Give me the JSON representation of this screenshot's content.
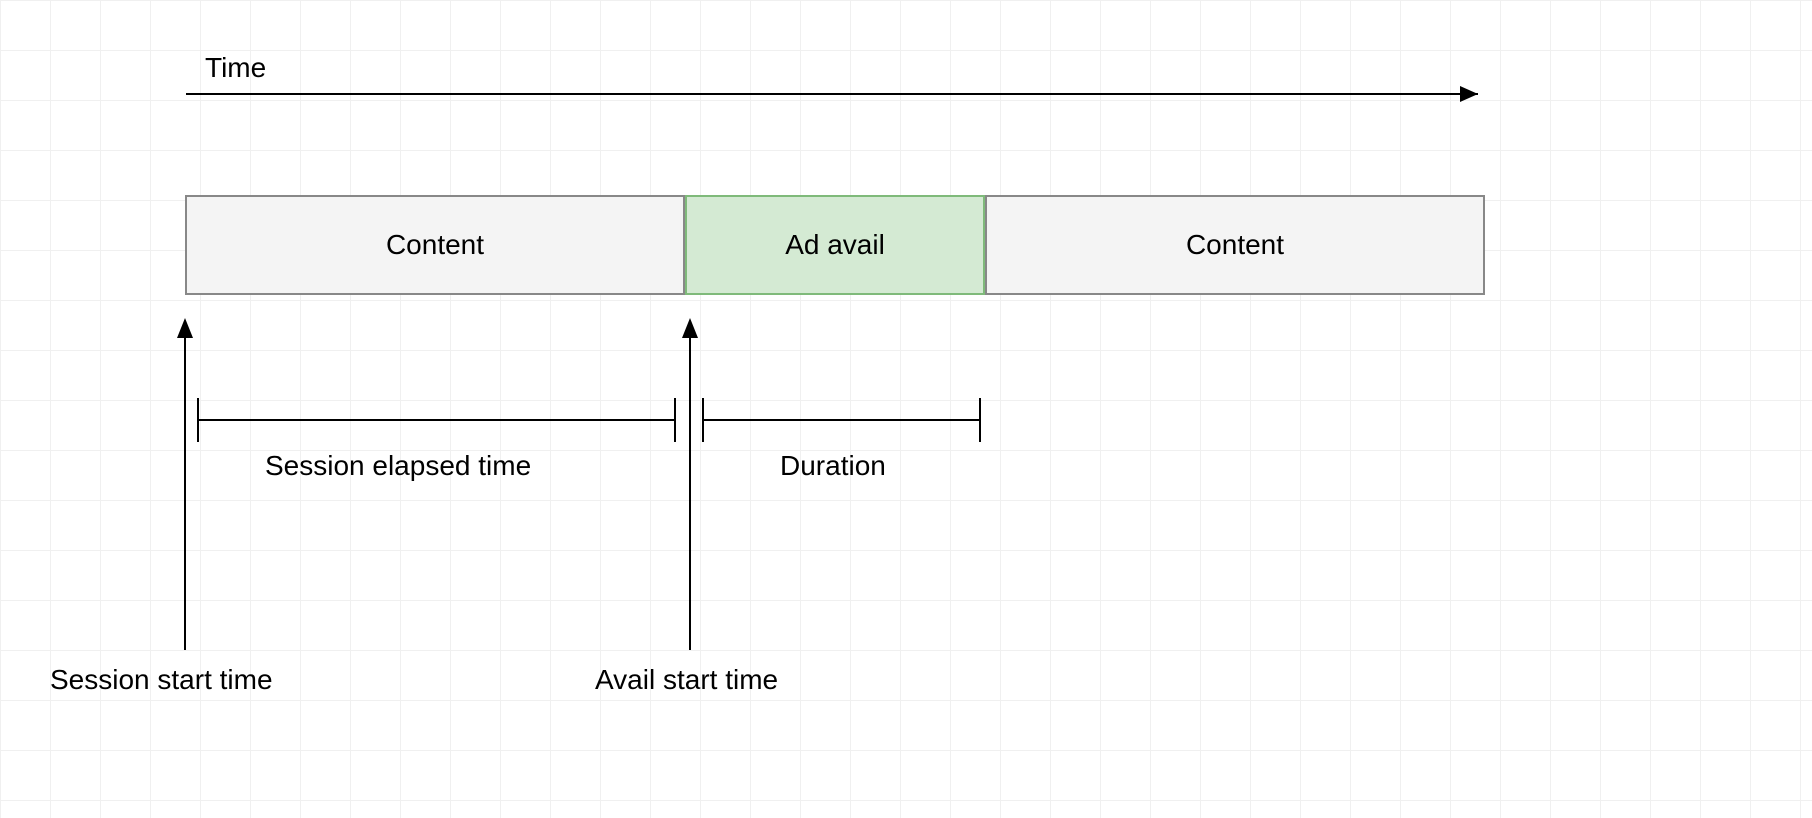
{
  "axis": {
    "label": "Time"
  },
  "blocks": {
    "content1": "Content",
    "adAvail": "Ad avail",
    "content2": "Content"
  },
  "annotations": {
    "sessionStart": "Session start time",
    "availStart": "Avail start time",
    "sessionElapsed": "Session elapsed time",
    "duration": "Duration"
  }
}
